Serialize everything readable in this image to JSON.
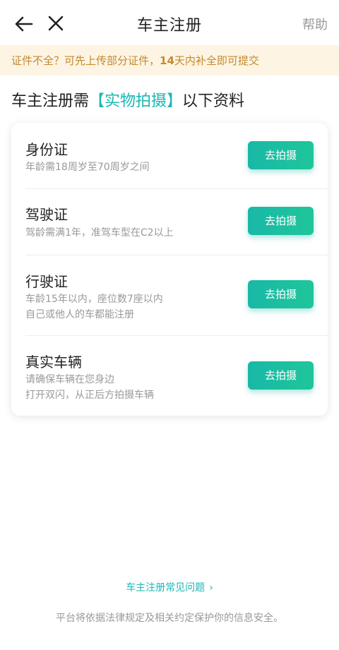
{
  "header": {
    "title": "车主注册",
    "help_label": "帮助",
    "back_icon": "back-arrow-icon",
    "close_icon": "close-icon"
  },
  "notice": {
    "text_before": "证件不全？可先上传部分证件，",
    "text_bold": "14",
    "text_after": "天内补全即可提交"
  },
  "headline": {
    "prefix": "车主注册需",
    "highlight": "【实物拍摄】",
    "suffix": "以下资料"
  },
  "items": [
    {
      "name": "身份证",
      "desc_line1": "年龄需18周岁至70周岁之间",
      "desc_line2": "",
      "button_label": "去拍摄"
    },
    {
      "name": "驾驶证",
      "desc_line1": "驾龄需满1年，准驾车型在C2以上",
      "desc_line2": "",
      "button_label": "去拍摄"
    },
    {
      "name": "行驶证",
      "desc_line1": "车龄15年以内，座位数7座以内",
      "desc_line2": "自己或他人的车都能注册",
      "button_label": "去拍摄"
    },
    {
      "name": "真实车辆",
      "desc_line1": "请确保车辆在您身边",
      "desc_line2": "打开双闪，从正后方拍摄车辆",
      "button_label": "去拍摄"
    }
  ],
  "faq_link": "车主注册常见问题",
  "footer_text": "平台将依据法律规定及相关约定保护你的信息安全。",
  "colors": {
    "accent": "#1ab7b4",
    "notice_bg": "#fdf4e3",
    "notice_text": "#c48a2d",
    "button_start": "#19b8a7",
    "button_end": "#1fc69a"
  }
}
